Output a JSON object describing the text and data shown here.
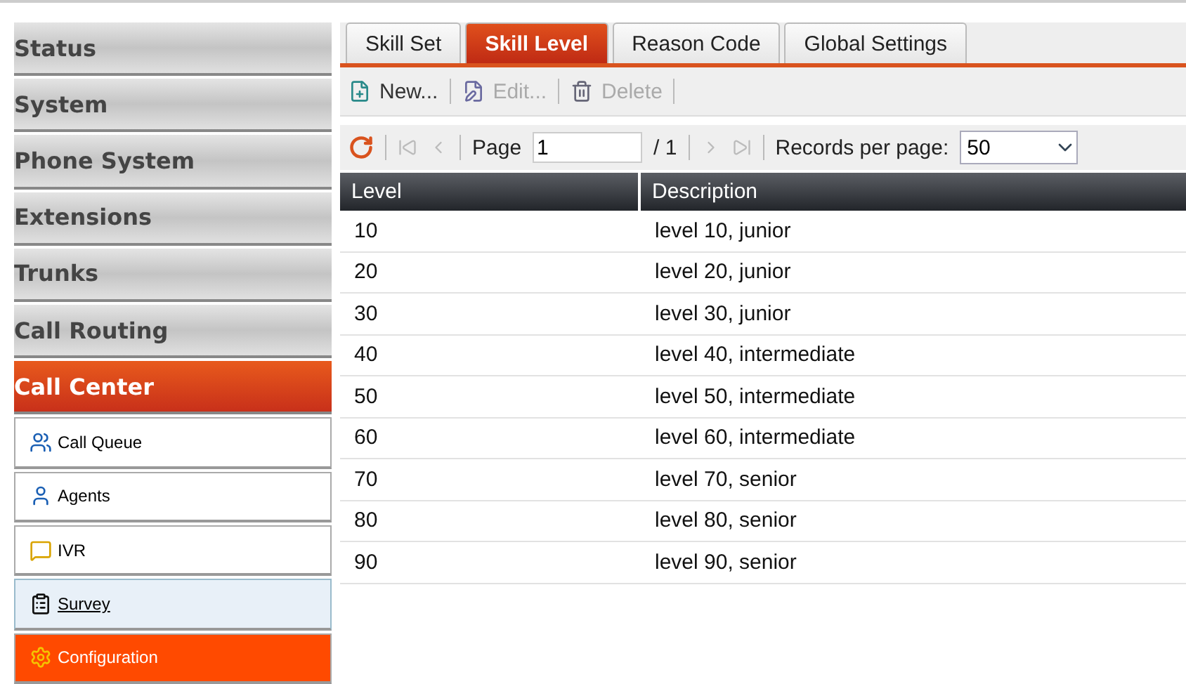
{
  "sidebar": {
    "sections": [
      {
        "label": "Status",
        "selected": false
      },
      {
        "label": "System",
        "selected": false
      },
      {
        "label": "Phone System",
        "selected": false
      },
      {
        "label": "Extensions",
        "selected": false
      },
      {
        "label": "Trunks",
        "selected": false
      },
      {
        "label": "Call Routing",
        "selected": false
      },
      {
        "label": "Call Center",
        "selected": true
      }
    ],
    "items": [
      {
        "label": "Call Queue",
        "kind": "queue",
        "selected": false,
        "highlighted": false
      },
      {
        "label": "Agents",
        "kind": "agent",
        "selected": false,
        "highlighted": false
      },
      {
        "label": "IVR",
        "kind": "ivr",
        "selected": false,
        "highlighted": false
      },
      {
        "label": "Survey",
        "kind": "survey",
        "selected": false,
        "highlighted": true
      },
      {
        "label": "Configuration",
        "kind": "gear",
        "selected": true,
        "highlighted": false
      }
    ]
  },
  "tabs": [
    {
      "label": "Skill Set",
      "selected": false
    },
    {
      "label": "Skill Level",
      "selected": true
    },
    {
      "label": "Reason Code",
      "selected": false
    },
    {
      "label": "Global Settings",
      "selected": false
    }
  ],
  "toolbar": [
    {
      "label": "New...",
      "kind": "new",
      "disabled": false
    },
    {
      "label": "Edit...",
      "kind": "edit",
      "disabled": true
    },
    {
      "label": "Delete",
      "kind": "delete",
      "disabled": true
    }
  ],
  "pager": {
    "page_label": "Page",
    "page": "1",
    "total": "/ 1",
    "records_label": "Records per page:",
    "records": "50"
  },
  "table": {
    "columns": [
      "Level",
      "Description"
    ],
    "rows": [
      [
        "10",
        "level 10, junior"
      ],
      [
        "20",
        "level 20, junior"
      ],
      [
        "30",
        "level 30, junior"
      ],
      [
        "40",
        "level 40, intermediate"
      ],
      [
        "50",
        "level 50, intermediate"
      ],
      [
        "60",
        "level 60, intermediate"
      ],
      [
        "70",
        "level 70, senior"
      ],
      [
        "80",
        "level 80, senior"
      ],
      [
        "90",
        "level 90, senior"
      ]
    ]
  }
}
